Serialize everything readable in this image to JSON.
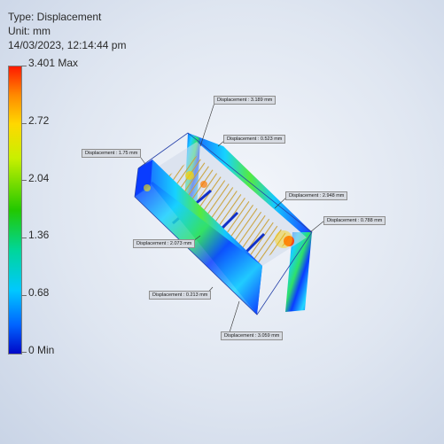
{
  "header": {
    "type_line": "Type: Displacement",
    "unit_line": "Unit: mm",
    "datetime_line": "14/03/2023, 12:14:44 pm"
  },
  "legend": {
    "max_label": "3.401 Max",
    "ticks": [
      "2.72",
      "2.04",
      "1.36",
      "0.68"
    ],
    "min_label": "0 Min"
  },
  "callouts": [
    "Displacement : 3.189 mm",
    "Displacement : 0.523 mm",
    "Displacement : 1.75 mm",
    "Displacement : 2.948 mm",
    "Displacement : 0.788 mm",
    "Displacement : 2.073 mm",
    "Displacement : 0.213 mm",
    "Displacement : 3.059 mm"
  ]
}
